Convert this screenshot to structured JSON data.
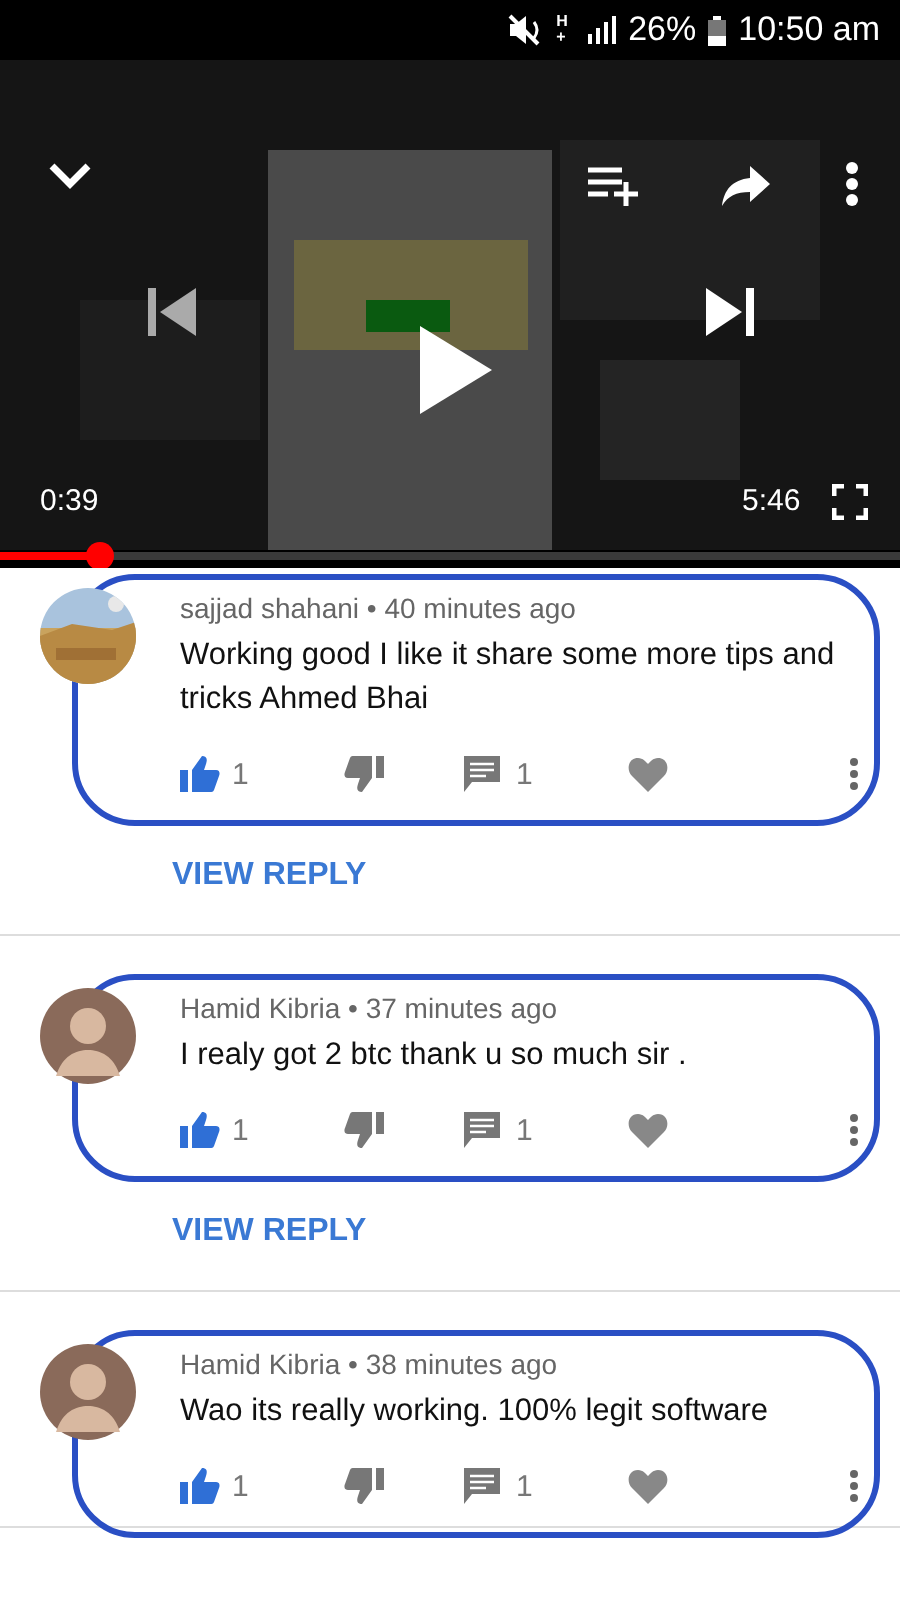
{
  "status_bar": {
    "network": "H+",
    "battery": "26%",
    "time": "10:50 am"
  },
  "player": {
    "elapsed": "0:39",
    "duration": "5:46",
    "level": 0.11,
    "paused": true
  },
  "comments": [
    {
      "byline": "sajjad shahani • 40 minutes ago",
      "text": "Working good I like it share some more tips and tricks Ahmed Bhai",
      "liked": true,
      "likes": "1",
      "replies": "1",
      "reply_link": "VIEW REPLY"
    },
    {
      "byline": "Hamid Kibria • 37 minutes ago",
      "text": "I realy got 2 btc thank u so much sir .",
      "avatar": {
        "kind": "avatar"
      },
      "liked": true,
      "likes": "1",
      "replies": "1",
      "reply_link": "VIEW REPLY"
    },
    {
      "byline": "Hamid Kibria • 38 minutes ago",
      "text": "Wao its really working. 100% legit software",
      "avatar": {
        "kind": "avatar"
      },
      "liked": true,
      "likes": "1",
      "replies": "1"
    }
  ]
}
